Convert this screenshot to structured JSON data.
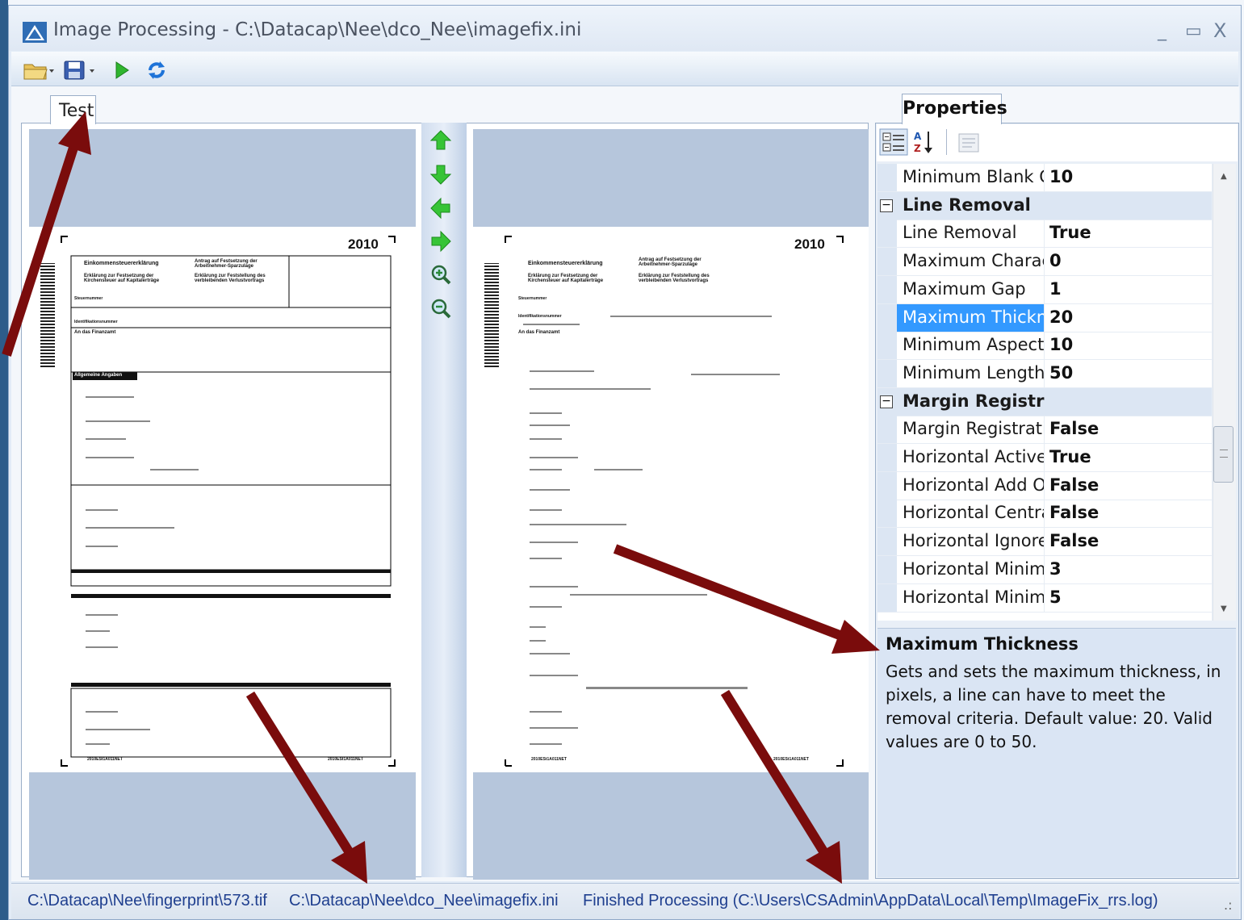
{
  "window": {
    "title": "Image Processing - C:\\Datacap\\Nee\\dco_Nee\\imagefix.ini",
    "minimize": "_",
    "maximize": "▭",
    "close": "X"
  },
  "toolbar": {
    "icons": [
      "open-folder-icon",
      "save-icon",
      "run-icon",
      "refresh-icon"
    ]
  },
  "tab": {
    "label": "Test"
  },
  "nav_icons": [
    "arrow-up-icon",
    "arrow-down-icon",
    "arrow-left-icon",
    "arrow-right-icon",
    "zoom-in-icon",
    "zoom-out-icon"
  ],
  "document": {
    "year": "2010",
    "heading1": "Einkommensteuererklärung",
    "heading2": "Antrag auf Festsetzung der Arbeitnehmer-Sparzulage",
    "heading3": "Erklärung zur Festsetzung der Kirchensteuer auf Kapitalerträge",
    "heading4": "Erklärung zur Feststellung des verbleibenden Verlustvortrags",
    "field_tax": "Steuernummer",
    "field_id": "Identifikationsnummer",
    "field_office": "An das Finanzamt",
    "section_general": "Allgemeine Angaben",
    "footer_code": "2010ESt1A011NET"
  },
  "properties": {
    "tab_label": "Properties",
    "rows": [
      {
        "type": "prop",
        "name": "Minimum Blank C",
        "value": "10"
      },
      {
        "type": "cat",
        "name": "Line Removal"
      },
      {
        "type": "prop",
        "name": "Line Removal",
        "value": "True"
      },
      {
        "type": "prop",
        "name": "Maximum Charac",
        "value": "0"
      },
      {
        "type": "prop",
        "name": "Maximum Gap",
        "value": "1"
      },
      {
        "type": "prop",
        "name": "Maximum Thickn",
        "value": "20",
        "selected": true
      },
      {
        "type": "prop",
        "name": "Minimum Aspect",
        "value": "10"
      },
      {
        "type": "prop",
        "name": "Minimum Length",
        "value": "50"
      },
      {
        "type": "cat",
        "name": "Margin Registration"
      },
      {
        "type": "prop",
        "name": "Margin Registratic",
        "value": "False"
      },
      {
        "type": "prop",
        "name": "Horizontal Active",
        "value": "True"
      },
      {
        "type": "prop",
        "name": "Horizontal Add Oı",
        "value": "False"
      },
      {
        "type": "prop",
        "name": "Horizontal Centra",
        "value": "False"
      },
      {
        "type": "prop",
        "name": "Horizontal Ignore",
        "value": "False"
      },
      {
        "type": "prop",
        "name": "Horizontal Minim",
        "value": "3"
      },
      {
        "type": "prop",
        "name": "Horizontal Minim",
        "value": "5"
      }
    ],
    "description": {
      "title": "Maximum Thickness",
      "text": "Gets and sets the maximum thickness, in pixels, a line can have to meet the removal criteria.  Default value: 20.  Valid values are 0 to 50."
    }
  },
  "status": {
    "image_path": "C:\\Datacap\\Nee\\fingerprint\\573.tif",
    "ini_path": "C:\\Datacap\\Nee\\dco_Nee\\imagefix.ini",
    "message": "Finished Processing (C:\\Users\\CSAdmin\\AppData\\Local\\Temp\\ImageFix_rrs.log)"
  },
  "colors": {
    "selection": "#3399ff",
    "annotation_arrow": "#7a0c0c",
    "nav_green": "#2bb52b"
  }
}
